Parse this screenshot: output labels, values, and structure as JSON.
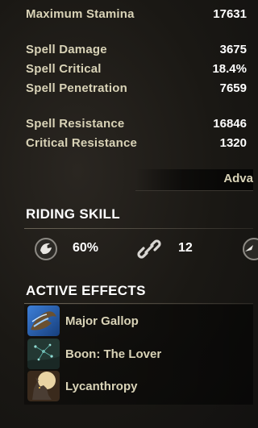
{
  "stats": {
    "maximum_stamina": {
      "label": "Maximum Stamina",
      "value": "17631"
    },
    "spell_damage": {
      "label": "Spell Damage",
      "value": "3675"
    },
    "spell_critical": {
      "label": "Spell Critical",
      "value": "18.4%"
    },
    "spell_penetration": {
      "label": "Spell Penetration",
      "value": "7659"
    },
    "spell_resistance": {
      "label": "Spell Resistance",
      "value": "16846"
    },
    "critical_resistance": {
      "label": "Critical Resistance",
      "value": "1320"
    }
  },
  "advanced_button": {
    "label": "Adva"
  },
  "riding_skill": {
    "title": "RIDING SKILL",
    "speed": {
      "icon": "horse-speed-icon",
      "value": "60%"
    },
    "capacity": {
      "icon": "chain-link-icon",
      "value": "12"
    },
    "stamina": {
      "icon": "horse-stamina-icon"
    }
  },
  "active_effects": {
    "title": "ACTIVE EFFECTS",
    "items": [
      {
        "name": "Major Gallop",
        "icon": "major-gallop-icon"
      },
      {
        "name": "Boon: The Lover",
        "icon": "boon-the-lover-icon"
      },
      {
        "name": "Lycanthropy",
        "icon": "lycanthropy-icon"
      }
    ]
  },
  "colors": {
    "label_text": "#d9d3b7",
    "value_text": "#ffffff",
    "background": "#1a1814"
  }
}
